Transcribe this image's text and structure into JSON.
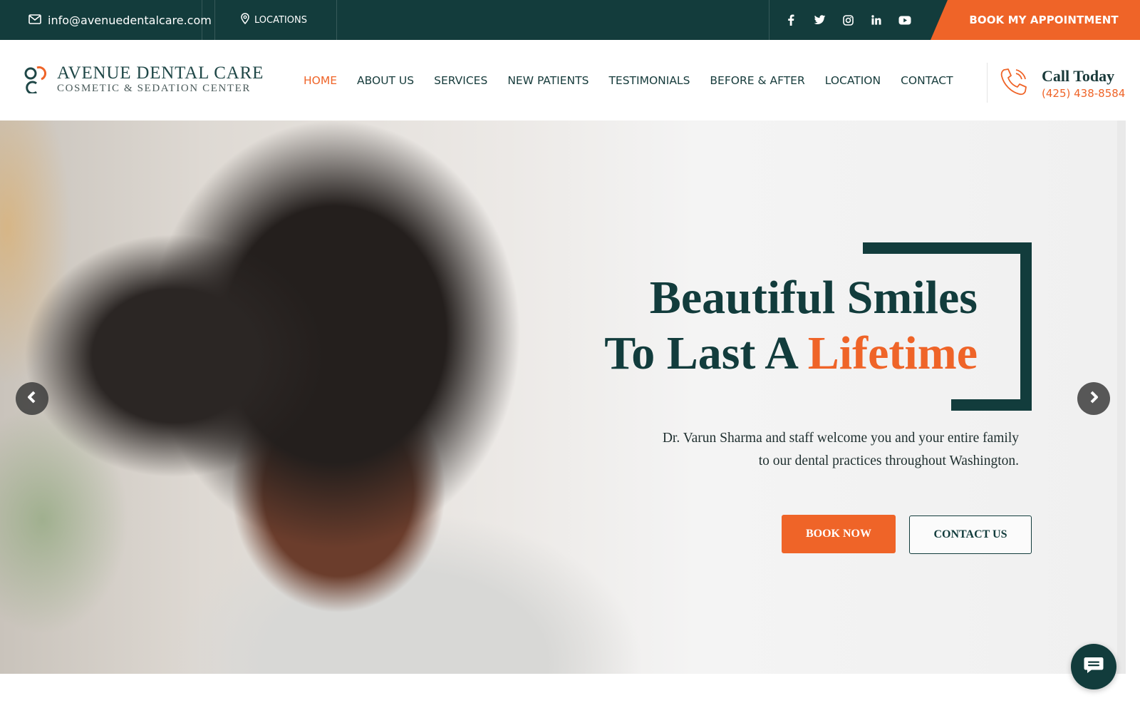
{
  "topbar": {
    "email": "info@avenuedentalcare.com",
    "locations_label": "LOCATIONS",
    "social_icons": [
      "facebook-icon",
      "twitter-icon",
      "instagram-icon",
      "linkedin-icon",
      "youtube-icon"
    ],
    "book_appointment_label": "BOOK MY APPOINTMENT"
  },
  "logo": {
    "line1": "AVENUE DENTAL CARE",
    "line2": "COSMETIC & SEDATION CENTER"
  },
  "nav": {
    "items": [
      {
        "label": "HOME",
        "active": true
      },
      {
        "label": "ABOUT US"
      },
      {
        "label": "SERVICES"
      },
      {
        "label": "NEW PATIENTS"
      },
      {
        "label": "TESTIMONIALS"
      },
      {
        "label": "BEFORE & AFTER"
      },
      {
        "label": "LOCATION"
      },
      {
        "label": "CONTACT"
      }
    ]
  },
  "call": {
    "title": "Call Today",
    "phone": "(425) 438-8584"
  },
  "hero": {
    "headline_line1": "Beautiful Smiles",
    "headline_line2_prefix": "To Last A ",
    "headline_line2_accent": "Lifetime",
    "subtext_line1": "Dr. Varun Sharma and staff welcome you and your entire family",
    "subtext_line2": "to our dental practices throughout Washington.",
    "book_now_label": "BOOK NOW",
    "contact_us_label": "CONTACT US"
  },
  "colors": {
    "brand_dark": "#133c3c",
    "accent": "#ef6428",
    "white": "#ffffff"
  }
}
